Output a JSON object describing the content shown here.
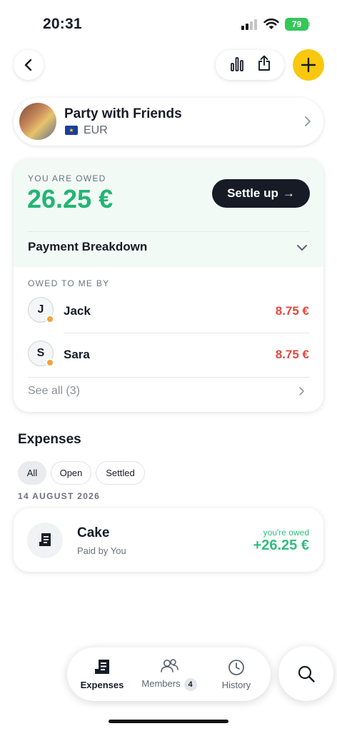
{
  "status_bar": {
    "time": "20:31",
    "battery": "79"
  },
  "header": {
    "back_icon": "chevron-left-icon",
    "stats_icon": "bar-chart-icon",
    "share_icon": "share-icon",
    "add_icon": "plus-icon"
  },
  "group": {
    "name": "Party with Friends",
    "currency": "EUR",
    "flag": "eu-flag-icon"
  },
  "balance": {
    "label": "YOU ARE OWED",
    "amount": "26.25 €",
    "settle_label": "Settle up",
    "settle_arrow": "→",
    "breakdown_title": "Payment Breakdown",
    "owed_by_label": "OWED TO ME BY",
    "people": [
      {
        "initial": "J",
        "name": "Jack",
        "amount": "8.75 €"
      },
      {
        "initial": "S",
        "name": "Sara",
        "amount": "8.75 €"
      }
    ],
    "see_all": "See all (3)"
  },
  "expenses": {
    "title": "Expenses",
    "filters": [
      {
        "label": "All",
        "active": true
      },
      {
        "label": "Open",
        "active": false
      },
      {
        "label": "Settled",
        "active": false
      }
    ],
    "date_label": "14 AUGUST 2026",
    "items": [
      {
        "name": "Cake",
        "paid_by": "Paid by You",
        "status": "you're owed",
        "amount": "+26.25 €"
      }
    ]
  },
  "bottom_nav": {
    "items": [
      {
        "label": "Expenses",
        "icon": "receipt-icon",
        "active": true
      },
      {
        "label": "Members",
        "icon": "members-icon",
        "badge": "4",
        "active": false
      },
      {
        "label": "History",
        "icon": "clock-icon",
        "active": false
      }
    ],
    "search_icon": "search-icon"
  },
  "colors": {
    "accent_yellow": "#f9c80e",
    "positive_green": "#22b573",
    "negative_red": "#e2483d",
    "dark": "#161b26"
  }
}
